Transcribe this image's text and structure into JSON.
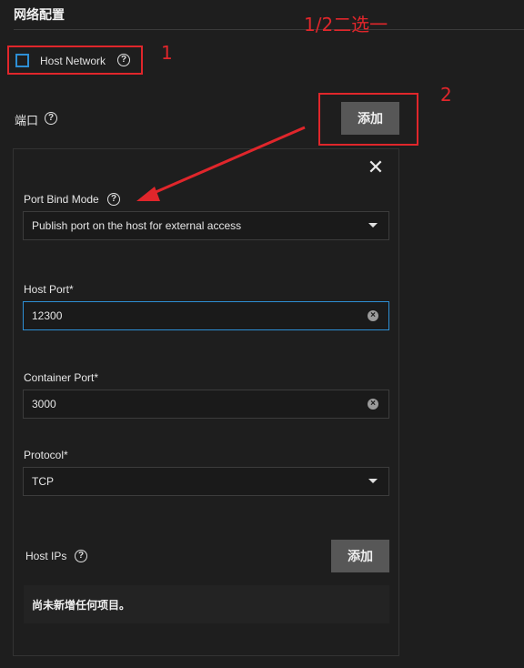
{
  "section": {
    "title": "网络配置"
  },
  "host_network": {
    "label": "Host Network",
    "help": "?"
  },
  "annotations": {
    "choose_one": "1/2二选一",
    "step1": "1",
    "step2": "2"
  },
  "ports": {
    "label": "端口",
    "help": "?",
    "add_label": "添加"
  },
  "port_form": {
    "close_symbol": "✕",
    "bind_mode": {
      "label": "Port Bind Mode",
      "help": "?",
      "value": "Publish port on the host for external access"
    },
    "host_port": {
      "label": "Host Port*",
      "value": "12300"
    },
    "container_port": {
      "label": "Container Port*",
      "value": "3000"
    },
    "protocol": {
      "label": "Protocol*",
      "value": "TCP"
    },
    "host_ips": {
      "label": "Host IPs",
      "help": "?",
      "add_label": "添加",
      "empty_text": "尚未新增任何项目。"
    }
  },
  "colors": {
    "accent": "#2d8fd5",
    "annotation": "#e0262b",
    "button": "#575757"
  },
  "icons": [
    "help-icon",
    "close-icon",
    "chevron-down-icon",
    "clear-icon",
    "annotation-arrow"
  ]
}
